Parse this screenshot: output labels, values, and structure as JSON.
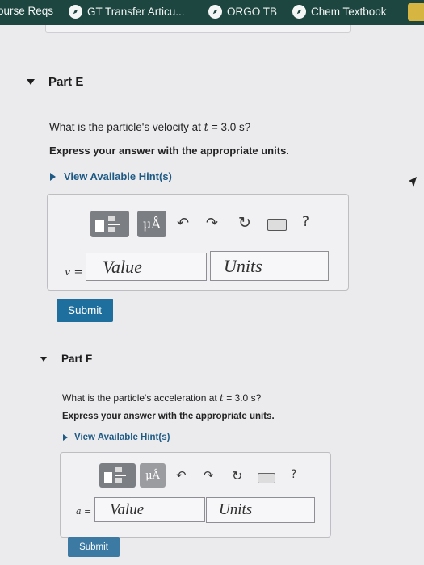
{
  "bookmarks": [
    {
      "label": "ourse Reqs",
      "has_icon": false
    },
    {
      "label": "GT Transfer Articu...",
      "has_icon": true,
      "icon": "safari-icon"
    },
    {
      "label": "ORGO TB",
      "has_icon": true,
      "icon": "safari-icon"
    },
    {
      "label": "Chem Textbook",
      "has_icon": true,
      "icon": "safari-icon"
    }
  ],
  "part_e": {
    "title": "Part E",
    "question_prefix": "What is the particle's velocity at ",
    "question_var": "t",
    "question_suffix": " = 3.0 s?",
    "instruction": "Express your answer with the appropriate units.",
    "hint_link": "View Available Hint(s)",
    "toolbar": {
      "mu_label": "μÅ",
      "help_label": "?",
      "icons": [
        "templates-icon",
        "units-icon",
        "undo-icon",
        "redo-icon",
        "reset-icon",
        "keyboard-icon",
        "help-icon"
      ]
    },
    "variable": "v =",
    "value_placeholder": "Value",
    "units_placeholder": "Units",
    "submit_label": "Submit"
  },
  "part_f": {
    "title": "Part F",
    "question_prefix": "What is the particle's acceleration at ",
    "question_var": "t",
    "question_suffix": " = 3.0 s?",
    "instruction": "Express your answer with the appropriate units.",
    "hint_link": "View Available Hint(s)",
    "toolbar": {
      "mu_label": "μÅ",
      "help_label": "?",
      "icons": [
        "templates-icon",
        "units-icon",
        "undo-icon",
        "redo-icon",
        "reset-icon",
        "keyboard-icon",
        "help-icon"
      ]
    },
    "variable": "a =",
    "value_placeholder": "Value",
    "units_placeholder": "Units",
    "submit_label": "Submit"
  },
  "colors": {
    "bookmark_bar": "#1e4641",
    "link": "#1e5a84",
    "submit": "#1f6f9e"
  }
}
